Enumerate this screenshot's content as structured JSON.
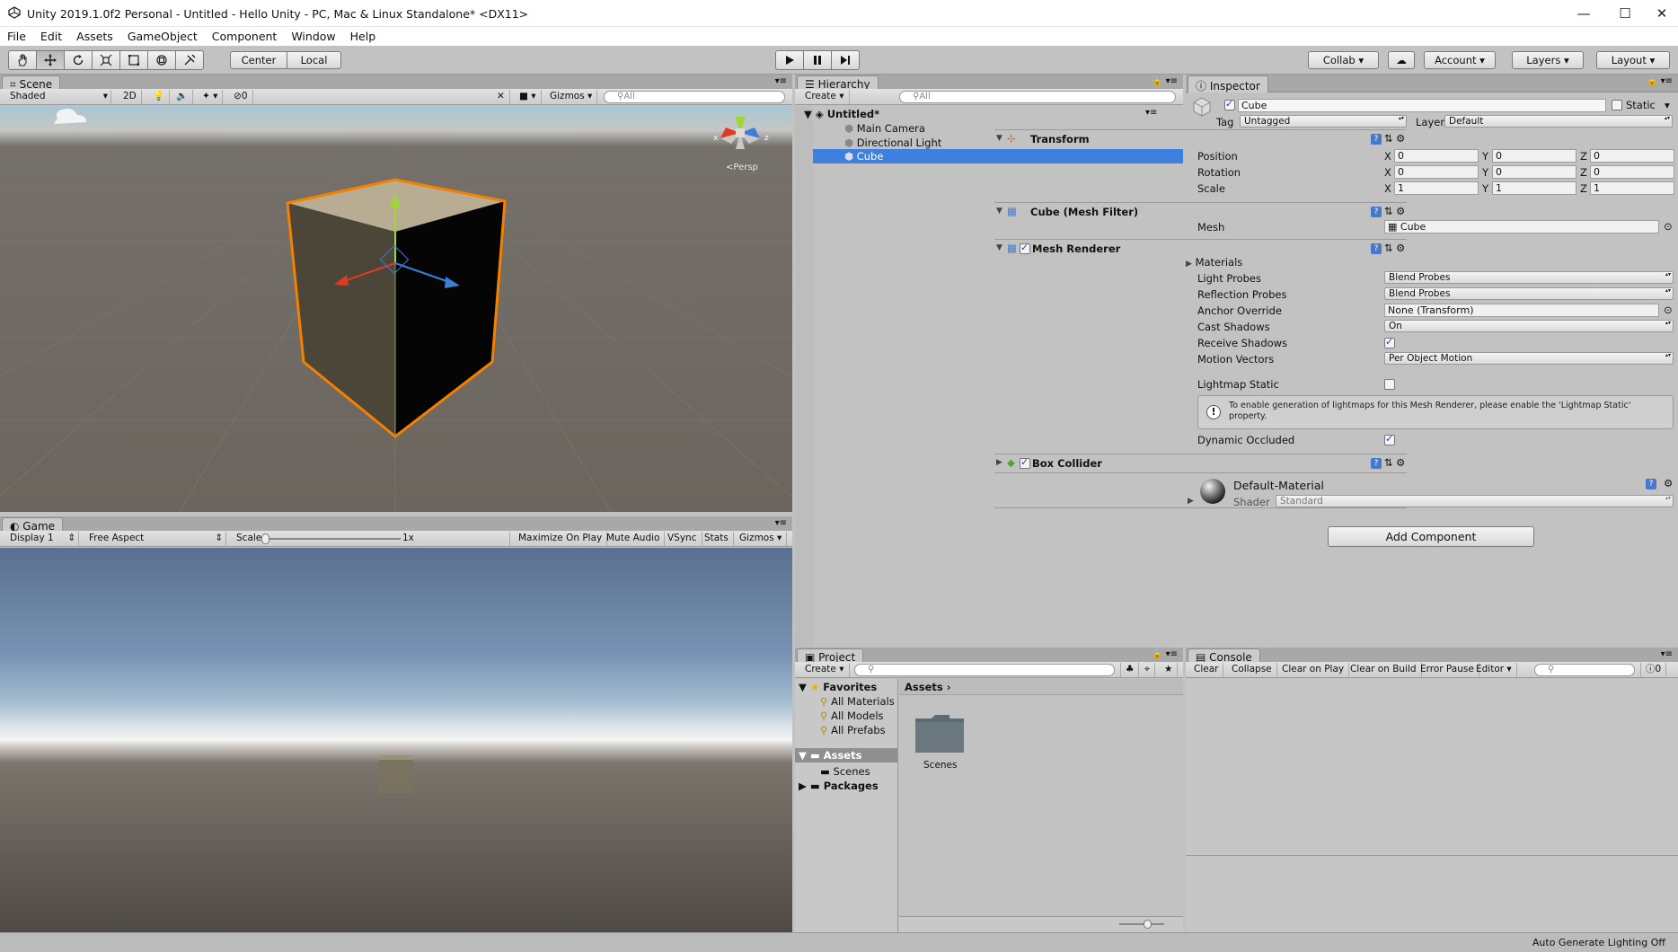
{
  "window": {
    "title": "Unity 2019.1.0f2 Personal - Untitled - Hello Unity - PC, Mac & Linux Standalone* <DX11>",
    "minimize": "—",
    "maximize": "☐",
    "close": "✕"
  },
  "menu": [
    "File",
    "Edit",
    "Assets",
    "GameObject",
    "Component",
    "Window",
    "Help"
  ],
  "toolbar": {
    "tools": [
      "hand-icon",
      "move-icon",
      "rotate-icon",
      "scale-icon",
      "rect-icon",
      "transform-icon",
      "custom-icon"
    ],
    "active_tool": "move-icon",
    "pivot": "Center",
    "space": "Local",
    "play": "play-icon",
    "pause": "pause-icon",
    "step": "step-icon",
    "collab": "Collab",
    "account": "Account",
    "layers": "Layers",
    "layout": "Layout"
  },
  "scene": {
    "tab": "Scene",
    "shading": "Shaded",
    "mode2d": "2D",
    "hidden_count": "0",
    "gizmos": "Gizmos",
    "search_placeholder": "All",
    "persp": "Persp",
    "axis_x": "x",
    "axis_z": "z"
  },
  "game": {
    "tab": "Game",
    "display": "Display 1",
    "aspect": "Free Aspect",
    "scale_label": "Scale",
    "scale_value": "1x",
    "maximize": "Maximize On Play",
    "mute": "Mute Audio",
    "vsync": "VSync",
    "stats": "Stats",
    "gizmos": "Gizmos"
  },
  "hierarchy": {
    "tab": "Hierarchy",
    "create": "Create",
    "search_placeholder": "All",
    "scene_name": "Untitled*",
    "items": [
      "Main Camera",
      "Directional Light",
      "Cube"
    ],
    "selected": "Cube"
  },
  "inspector": {
    "tab": "Inspector",
    "object_name": "Cube",
    "static_label": "Static",
    "tag_label": "Tag",
    "tag_value": "Untagged",
    "layer_label": "Layer",
    "layer_value": "Default",
    "transform": {
      "title": "Transform",
      "rows": [
        {
          "label": "Position",
          "x": "0",
          "y": "0",
          "z": "0"
        },
        {
          "label": "Rotation",
          "x": "0",
          "y": "0",
          "z": "0"
        },
        {
          "label": "Scale",
          "x": "1",
          "y": "1",
          "z": "1"
        }
      ],
      "x": "X",
      "y": "Y",
      "z": "Z"
    },
    "mesh_filter": {
      "title": "Cube (Mesh Filter)",
      "mesh_label": "Mesh",
      "mesh_value": "Cube"
    },
    "mesh_renderer": {
      "title": "Mesh Renderer",
      "materials": "Materials",
      "light_probes_label": "Light Probes",
      "light_probes": "Blend Probes",
      "reflection_probes_label": "Reflection Probes",
      "reflection_probes": "Blend Probes",
      "anchor_override_label": "Anchor Override",
      "anchor_override": "None (Transform)",
      "cast_shadows_label": "Cast Shadows",
      "cast_shadows": "On",
      "receive_shadows_label": "Receive Shadows",
      "motion_vectors_label": "Motion Vectors",
      "motion_vectors": "Per Object Motion",
      "lightmap_static_label": "Lightmap Static",
      "info": "To enable generation of lightmaps for this Mesh Renderer, please enable the 'Lightmap Static' property.",
      "dynamic_occluded_label": "Dynamic Occluded"
    },
    "box_collider": "Box Collider",
    "material": {
      "name": "Default-Material",
      "shader_label": "Shader",
      "shader": "Standard"
    },
    "add_component": "Add Component"
  },
  "project": {
    "tab": "Project",
    "create": "Create",
    "favorites": "Favorites",
    "fav_items": [
      "All Materials",
      "All Models",
      "All Prefabs"
    ],
    "assets": "Assets",
    "asset_children": [
      "Scenes"
    ],
    "packages": "Packages",
    "breadcrumb": "Assets",
    "folder_items": [
      "Scenes"
    ]
  },
  "console": {
    "tab": "Console",
    "buttons": [
      "Clear",
      "Collapse",
      "Clear on Play",
      "Clear on Build",
      "Error Pause",
      "Editor"
    ],
    "count": "0"
  },
  "status": {
    "text": "Auto Generate Lighting Off"
  },
  "colors": {
    "selection": "#3d80df",
    "accent_orange": "#f77f00",
    "panel": "#c2c2c2"
  }
}
